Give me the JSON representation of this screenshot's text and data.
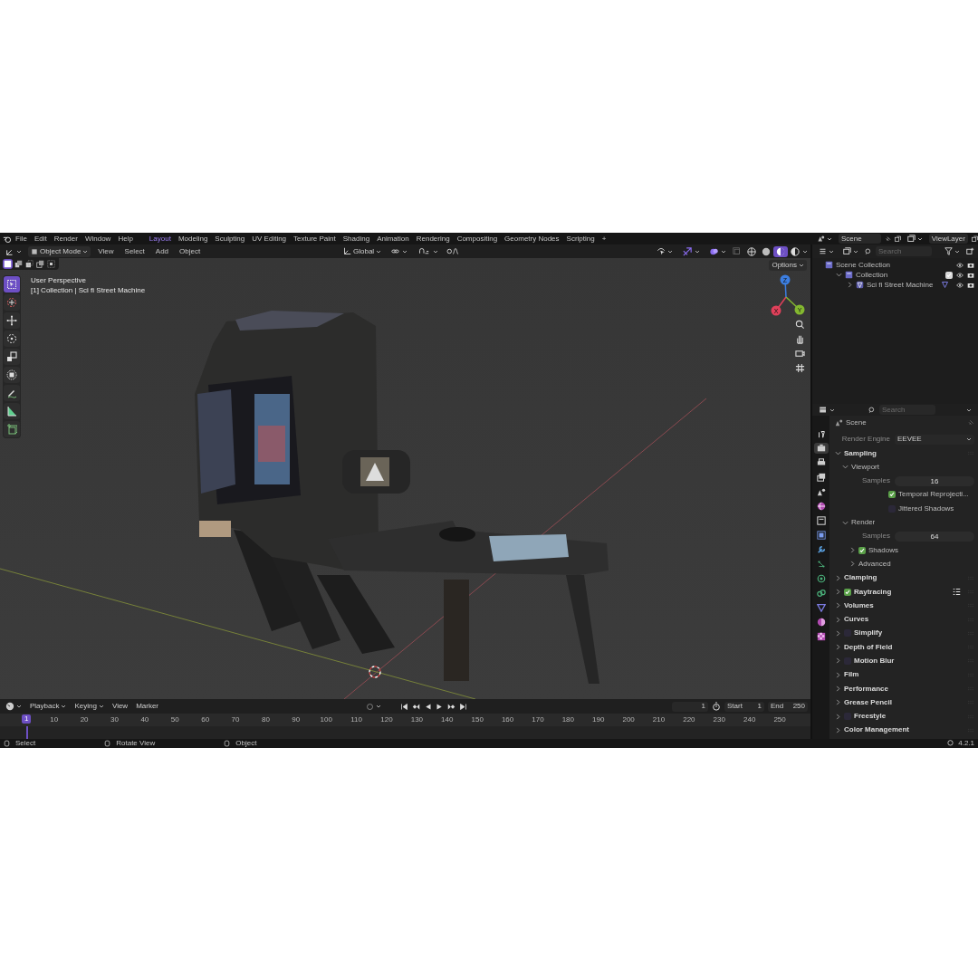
{
  "menu": [
    "File",
    "Edit",
    "Render",
    "Window",
    "Help"
  ],
  "workspaces": [
    {
      "label": "Layout",
      "selected": true
    },
    {
      "label": "Modeling",
      "selected": false
    },
    {
      "label": "Sculpting",
      "selected": false
    },
    {
      "label": "UV Editing",
      "selected": false
    },
    {
      "label": "Texture Paint",
      "selected": false
    },
    {
      "label": "Shading",
      "selected": false
    },
    {
      "label": "Animation",
      "selected": false
    },
    {
      "label": "Rendering",
      "selected": false
    },
    {
      "label": "Compositing",
      "selected": false
    },
    {
      "label": "Geometry Nodes",
      "selected": false
    },
    {
      "label": "Scripting",
      "selected": false
    }
  ],
  "add_workspace": "+",
  "scene": "Scene",
  "view_layer": "ViewLayer",
  "viewport_header": {
    "mode": "Object Mode",
    "menus": [
      "View",
      "Select",
      "Add",
      "Object"
    ],
    "orientation": "Global",
    "shading_modes": [
      {
        "kind": "wireframe",
        "selected": false
      },
      {
        "kind": "solid",
        "selected": false
      },
      {
        "kind": "material",
        "selected": true
      },
      {
        "kind": "rendered",
        "selected": false
      }
    ]
  },
  "viewport": {
    "selection_modes": [
      {
        "kind": "set",
        "selected": true
      },
      {
        "kind": "extend",
        "selected": false
      },
      {
        "kind": "subtract",
        "selected": false
      },
      {
        "kind": "invert",
        "selected": false
      },
      {
        "kind": "intersect",
        "selected": false
      }
    ],
    "options": "Options",
    "view_name": "User Perspective",
    "object_path": "[1] Collection | Sci fi Street Machine",
    "tools": [
      {
        "kind": "select-box",
        "selected": true
      },
      {
        "kind": "cursor",
        "selected": false
      },
      {
        "kind": "move",
        "selected": false
      },
      {
        "kind": "rotate",
        "selected": false
      },
      {
        "kind": "scale",
        "selected": false
      },
      {
        "kind": "transform",
        "selected": false
      },
      {
        "kind": "annotate",
        "selected": false
      },
      {
        "kind": "measure",
        "selected": false
      },
      {
        "kind": "add-cube",
        "selected": false
      }
    ],
    "gizmo_axes": [
      "X",
      "Y",
      "Z"
    ]
  },
  "outliner": {
    "search_placeholder": "Search",
    "items": [
      {
        "kind": "scene_collection",
        "label": "Scene Collection",
        "children": [
          {
            "kind": "collection",
            "label": "Collection",
            "expanded": true,
            "checked": true,
            "children": [
              {
                "kind": "object",
                "label": "Sci fi Street Machine",
                "expanded": false
              }
            ]
          }
        ]
      }
    ]
  },
  "properties": {
    "search_placeholder": "Search",
    "context": "Scene",
    "tabs": [
      {
        "kind": "tool",
        "selected": false
      },
      {
        "kind": "render",
        "selected": true
      },
      {
        "kind": "output",
        "selected": false
      },
      {
        "kind": "view-layer",
        "selected": false
      },
      {
        "kind": "scene",
        "selected": false
      },
      {
        "kind": "world",
        "selected": false
      },
      {
        "kind": "collection",
        "selected": false
      },
      {
        "kind": "object",
        "selected": false
      },
      {
        "kind": "modifier",
        "selected": false
      },
      {
        "kind": "particles",
        "selected": false
      },
      {
        "kind": "physics",
        "selected": false
      },
      {
        "kind": "constraints",
        "selected": false
      },
      {
        "kind": "data",
        "selected": false
      },
      {
        "kind": "material",
        "selected": false
      },
      {
        "kind": "texture",
        "selected": false
      }
    ],
    "render_engine_label": "Render Engine",
    "render_engine": "EEVEE",
    "sections": [
      {
        "kind": "panel",
        "label": "Sampling",
        "expanded": true,
        "children": [
          {
            "kind": "panel",
            "label": "Viewport",
            "expanded": true,
            "children": [
              {
                "kind": "number",
                "label": "Samples",
                "value": "16"
              },
              {
                "kind": "checkbox",
                "label": "Temporal Reprojecti...",
                "checked": true
              },
              {
                "kind": "checkbox",
                "label": "Jittered Shadows",
                "checked": false
              }
            ]
          },
          {
            "kind": "panel",
            "label": "Render",
            "expanded": true,
            "children": [
              {
                "kind": "number",
                "label": "Samples",
                "value": "64"
              },
              {
                "kind": "panel",
                "label": "Shadows",
                "expanded": false,
                "checked": true
              },
              {
                "kind": "panel",
                "label": "Advanced",
                "expanded": false
              }
            ]
          }
        ]
      },
      {
        "kind": "panel",
        "label": "Clamping",
        "expanded": false
      },
      {
        "kind": "panel",
        "label": "Raytracing",
        "expanded": false,
        "checked": true,
        "presets_menu": true
      },
      {
        "kind": "panel",
        "label": "Volumes",
        "expanded": false
      },
      {
        "kind": "panel",
        "label": "Curves",
        "expanded": false
      },
      {
        "kind": "panel",
        "label": "Simplify",
        "expanded": false,
        "checked": false
      },
      {
        "kind": "panel",
        "label": "Depth of Field",
        "expanded": false
      },
      {
        "kind": "panel",
        "label": "Motion Blur",
        "expanded": false,
        "checked": false
      },
      {
        "kind": "panel",
        "label": "Film",
        "expanded": false
      },
      {
        "kind": "panel",
        "label": "Performance",
        "expanded": false
      },
      {
        "kind": "panel",
        "label": "Grease Pencil",
        "expanded": false
      },
      {
        "kind": "panel",
        "label": "Freestyle",
        "expanded": false,
        "checked": false
      },
      {
        "kind": "panel",
        "label": "Color Management",
        "expanded": false
      }
    ]
  },
  "timeline": {
    "menus": [
      {
        "label": "Playback",
        "dropdown": true
      },
      {
        "label": "Keying",
        "dropdown": true
      },
      {
        "label": "View",
        "dropdown": false
      },
      {
        "label": "Marker",
        "dropdown": false
      }
    ],
    "current_frame": "1",
    "start_label": "Start",
    "start": "1",
    "end_label": "End",
    "end": "250",
    "playhead": "1",
    "ruler": [
      "10",
      "20",
      "30",
      "40",
      "50",
      "60",
      "70",
      "80",
      "90",
      "100",
      "110",
      "120",
      "130",
      "140",
      "150",
      "160",
      "170",
      "180",
      "190",
      "200",
      "210",
      "220",
      "230",
      "240",
      "250"
    ]
  },
  "status_bar": {
    "items": [
      "Select",
      "Rotate View",
      "Object"
    ],
    "version": "4.2.1"
  }
}
